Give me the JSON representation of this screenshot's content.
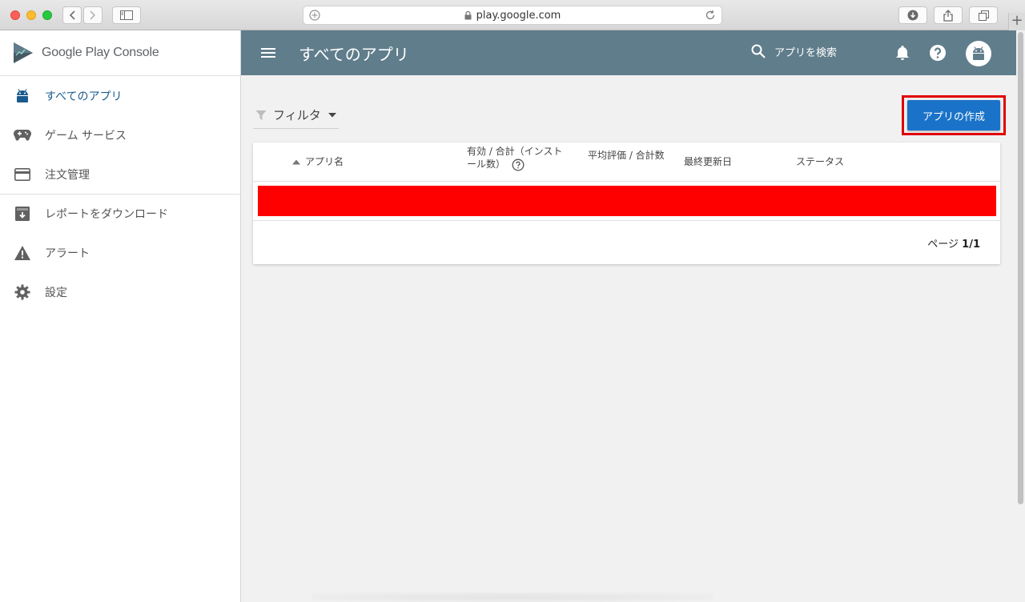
{
  "browser": {
    "url": "play.google.com"
  },
  "app": {
    "logo_text_1": "Google Play",
    "logo_text_2": " Console"
  },
  "sidebar": {
    "items": [
      {
        "label": "すべてのアプリ",
        "icon": "android-icon",
        "active": true
      },
      {
        "label": "ゲーム サービス",
        "icon": "gamepad-icon"
      },
      {
        "label": "注文管理",
        "icon": "credit-card-icon"
      },
      {
        "label": "レポートをダウンロード",
        "icon": "download-box-icon"
      },
      {
        "label": "アラート",
        "icon": "warning-icon"
      },
      {
        "label": "設定",
        "icon": "gear-icon"
      }
    ]
  },
  "header": {
    "title": "すべてのアプリ",
    "search_placeholder": "アプリを検索"
  },
  "toolbar": {
    "filter_label": "フィルタ",
    "create_label": "アプリの作成"
  },
  "table": {
    "columns": {
      "name": "アプリ名",
      "installs": "有効 / 合計（インストール数）",
      "rating": "平均評価 / 合計数",
      "updated": "最終更新日",
      "status": "ステータス"
    },
    "pager_prefix": "ページ ",
    "pager_value": "1/1"
  },
  "colors": {
    "topbar": "#607d8b",
    "accent": "#1a73c8",
    "highlight": "#e00000",
    "redacted_row": "#ff0000"
  }
}
